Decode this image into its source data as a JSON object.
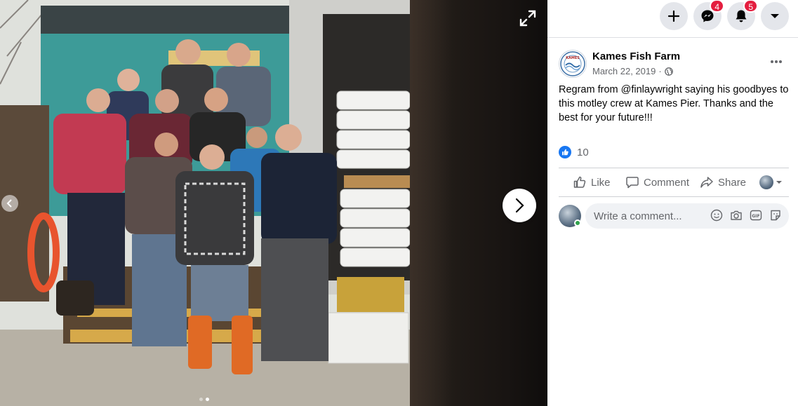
{
  "viewer": {
    "expand_icon": "expand-icon",
    "next_icon": "chevron-right-icon",
    "prev_icon": "chevron-left-icon",
    "photo_count": 2,
    "active_photo": 2
  },
  "topbar": {
    "create_icon": "plus-icon",
    "messenger_icon": "messenger-icon",
    "messenger_badge": "4",
    "notifications_icon": "bell-icon",
    "notifications_badge": "5",
    "account_icon": "caret-down-icon"
  },
  "post": {
    "page_name": "Kames Fish Farm",
    "logo_text": "KAMES",
    "date": "March 22, 2019",
    "separator": "·",
    "privacy_icon": "globe-icon",
    "caption": "Regram from @finlaywright saying his goodbyes to this motley crew at Kames Pier. Thanks and the best for your future!!!",
    "reaction_icon": "like-reaction-icon",
    "reaction_count": "10"
  },
  "actions": {
    "like": "Like",
    "comment": "Comment",
    "share": "Share"
  },
  "comment": {
    "placeholder": "Write a comment...",
    "icons": [
      "emoji-icon",
      "camera-icon",
      "gif-icon",
      "sticker-icon"
    ]
  },
  "colors": {
    "accent": "#1877f2",
    "badge": "#e41e3f",
    "online": "#31a24c"
  }
}
